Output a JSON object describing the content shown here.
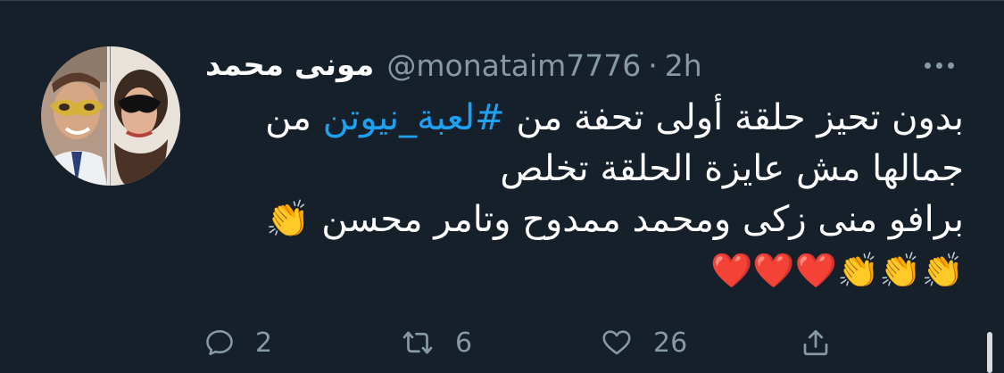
{
  "tweet": {
    "author_name": "مونى محمد",
    "handle": "@monataim7776",
    "separator": "·",
    "time": "2h",
    "line1_before": "بدون تحيز حلقة أولى تحفة من ",
    "hashtag": "#لعبة_نيوتن",
    "line1_after": " من",
    "line2": "جمالها مش عايزة الحلقة تخلص",
    "line3": "برافو منى زكى ومحمد ممدوح وتامر محسن 👏",
    "line4": "👏👏👏❤️❤️❤️"
  },
  "actions": {
    "reply_count": "2",
    "retweet_count": "6",
    "like_count": "26"
  },
  "icons": {
    "more": "more-horizontal-icon",
    "reply": "reply-icon",
    "retweet": "retweet-icon",
    "like": "heart-icon",
    "share": "share-icon"
  },
  "colors": {
    "background": "#15202b",
    "text": "#ffffff",
    "secondary": "#8899a6",
    "hashtag": "#1da1f2"
  }
}
